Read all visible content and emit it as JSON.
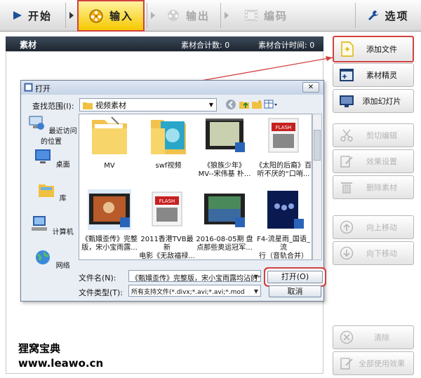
{
  "toolbar": {
    "tabs": [
      {
        "label": "开始"
      },
      {
        "label": "输入"
      },
      {
        "label": "输出"
      },
      {
        "label": "编码"
      },
      {
        "label": "选项"
      }
    ]
  },
  "material_panel": {
    "title": "素材",
    "count_label": "素材合计数: 0",
    "time_label": "素材合计时间: 0"
  },
  "side_buttons": [
    {
      "label": "添加文件"
    },
    {
      "label": "素材精灵"
    },
    {
      "label": "添加幻灯片"
    },
    {
      "label": "剪切编辑"
    },
    {
      "label": "效果设置"
    },
    {
      "label": "删除素材"
    },
    {
      "label": "向上移动"
    },
    {
      "label": "向下移动"
    },
    {
      "label": "清除"
    },
    {
      "label": "全部使用效果"
    }
  ],
  "dialog": {
    "title": "打开",
    "close_symbol": "✕",
    "look_in_label": "查找范围(I):",
    "look_in_value": "视频素材",
    "places": [
      {
        "label": "最近访问的位置"
      },
      {
        "label": "桌面"
      },
      {
        "label": "库"
      },
      {
        "label": "计算机"
      },
      {
        "label": "网络"
      }
    ],
    "files": [
      {
        "line1": "MV",
        "line2": ""
      },
      {
        "line1": "swf视频",
        "line2": ""
      },
      {
        "line1": "《狼族少年》",
        "line2": "MV--宋伟基 朴..."
      },
      {
        "line1": "《太阳的后裔》百",
        "line2": "听不厌的“口哨..."
      },
      {
        "line1": "《甄嬛歪传》完整",
        "line2": "版，宋小宝雨露..."
      },
      {
        "line1": "2011香港TVB最新",
        "line2": "电影《无敌福禄..."
      },
      {
        "line1": "2016-08-05期 盘",
        "line2": "点那些奥运冠军..."
      },
      {
        "line1": "F4-流星雨_国语_流",
        "line2": "行（音轨合并）"
      }
    ],
    "flash_badge": "FLASH",
    "file_name_label": "文件名(N):",
    "file_name_value": "《甄嬛歪传》完整版，宋小宝雨露均沾的\"",
    "file_type_label": "文件类型(T):",
    "file_type_value": "所有支持文件(*.divx;*.avi;*.avi;*.mod",
    "open_label": "打开(O)",
    "cancel_label": "取消"
  },
  "watermark": {
    "line1": "狸窝宝典",
    "line2": "www.leawo.cn"
  },
  "accent_colors": {
    "highlight_border": "#d24040",
    "active_tab": "#f5c800",
    "panel_header": "#2a3440"
  }
}
